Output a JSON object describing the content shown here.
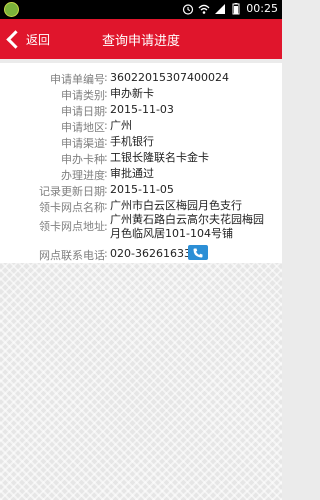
{
  "status_bar": {
    "time": "00:25",
    "icons": [
      "app-notification-icon",
      "alarm-icon",
      "wifi-icon",
      "signal-icon",
      "battery-icon"
    ]
  },
  "header": {
    "back_label": "返回",
    "title": "查询申请进度",
    "background": "#e0152c"
  },
  "details": [
    {
      "label": "申请单编号",
      "value": "36022015307400024"
    },
    {
      "label": "申请类别",
      "value": "申办新卡"
    },
    {
      "label": "申请日期",
      "value": "2015-11-03"
    },
    {
      "label": "申请地区",
      "value": "广州"
    },
    {
      "label": "申请渠道",
      "value": "手机银行"
    },
    {
      "label": "申办卡种",
      "value": "工银长隆联名卡金卡"
    },
    {
      "label": "办理进度",
      "value": "审批通过"
    },
    {
      "label": "记录更新日期",
      "value": "2015-11-05"
    },
    {
      "label": "领卡网点名称",
      "value": "广州市白云区梅园月色支行"
    },
    {
      "label": "领卡网点地址",
      "value": "广州黄石路白云高尔夫花园梅园月色临风居101-104号铺"
    },
    {
      "label": "网点联系电话",
      "value": "020-36261633"
    }
  ],
  "colors": {
    "accent": "#e0152c",
    "phone_button": "#2c8fd6",
    "label_text": "#808080",
    "value_text": "#222222"
  }
}
